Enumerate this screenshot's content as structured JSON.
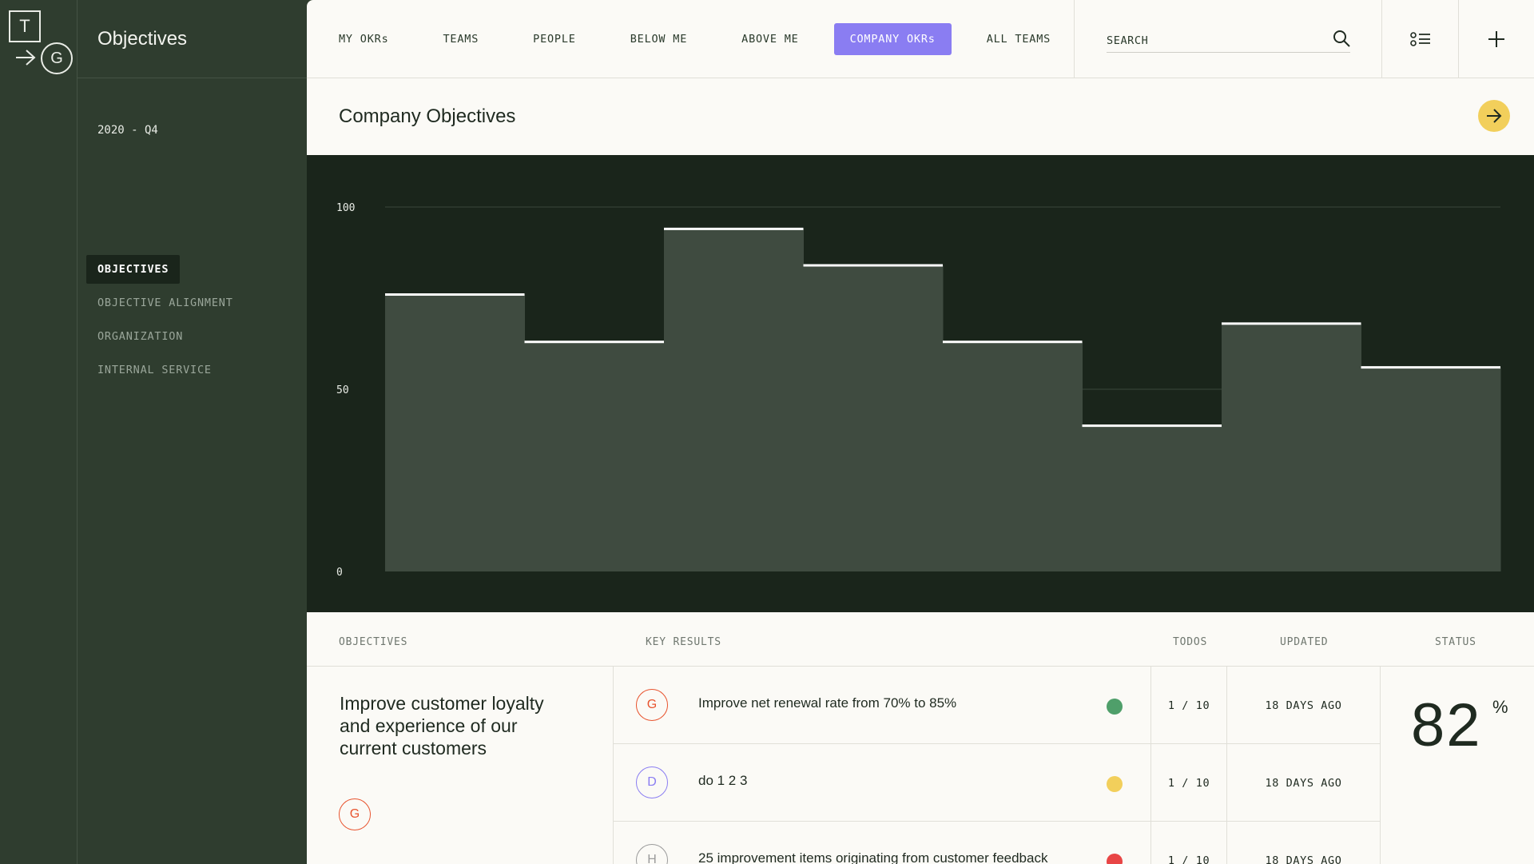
{
  "brand": {
    "logo_top": "T",
    "logo_bottom": "G"
  },
  "sidebar": {
    "title": "Objectives",
    "period": "2020 - Q4",
    "items": [
      {
        "label": "OBJECTIVES",
        "active": true
      },
      {
        "label": "OBJECTIVE ALIGNMENT",
        "active": false
      },
      {
        "label": "ORGANIZATION",
        "active": false
      },
      {
        "label": "INTERNAL SERVICE",
        "active": false
      }
    ]
  },
  "topbar": {
    "tabs": [
      {
        "label": "MY OKRs",
        "active": false
      },
      {
        "label": "TEAMS",
        "active": false
      },
      {
        "label": "PEOPLE",
        "active": false
      },
      {
        "label": "BELOW ME",
        "active": false
      },
      {
        "label": "ABOVE ME",
        "active": false
      },
      {
        "label": "COMPANY OKRs",
        "active": true
      },
      {
        "label": "ALL TEAMS",
        "active": false
      }
    ],
    "search_placeholder": "SEARCH"
  },
  "section": {
    "title": "Company Objectives"
  },
  "chart_data": {
    "type": "area",
    "x": [
      1,
      2,
      3,
      4,
      5,
      6,
      7,
      8
    ],
    "values": [
      76,
      63,
      94,
      84,
      63,
      40,
      68,
      56
    ],
    "ylim": [
      0,
      100
    ],
    "yticks": [
      "100",
      "50",
      "0"
    ],
    "grid": true,
    "colors": {
      "background": "#1a251b",
      "fill": "#3f4b40",
      "step_line": "#ffffff",
      "grid": "#3a463b"
    }
  },
  "table": {
    "headers": {
      "objectives": "OBJECTIVES",
      "key_results": "KEY RESULTS",
      "todos": "TODOS",
      "updated": "UPDATED",
      "status": "STATUS"
    },
    "objective": {
      "text": "Improve customer loyalty and experience of our current customers",
      "owner": "G",
      "status_value": "82",
      "status_unit": "%"
    },
    "key_results": [
      {
        "avatar": "G",
        "avatar_color": "#e8542f",
        "text": "Improve net renewal rate from 70% to 85%",
        "dot": "#4f9f6a",
        "todos": "1 / 10",
        "updated": "18 DAYS AGO"
      },
      {
        "avatar": "D",
        "avatar_color": "#8a7df2",
        "text": "do 1 2 3",
        "dot": "#f2cf5b",
        "todos": "1 / 10",
        "updated": "18 DAYS AGO"
      },
      {
        "avatar": "H",
        "avatar_color": "#9b9b9b",
        "text": "25 improvement items originating from customer feedback",
        "dot": "#e84545",
        "todos": "1 / 10",
        "updated": "18 DAYS AGO"
      }
    ]
  }
}
